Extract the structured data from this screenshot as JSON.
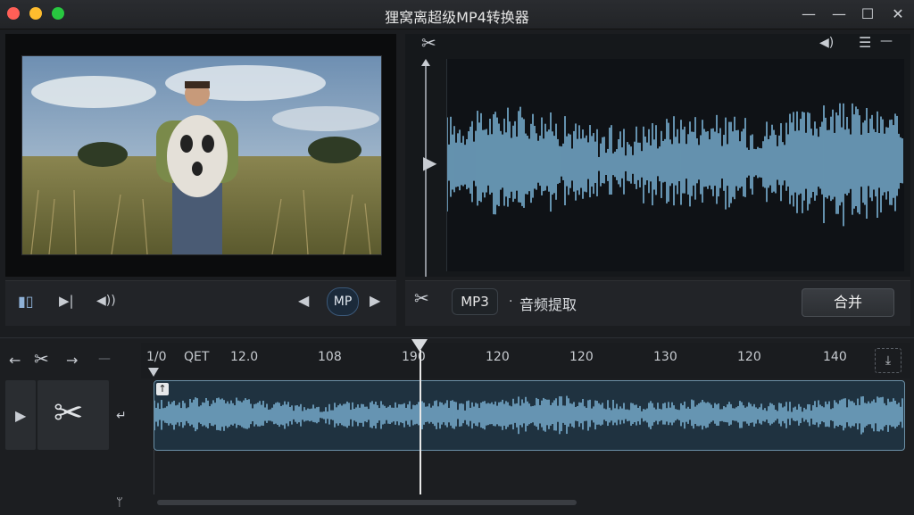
{
  "app": {
    "title": "狸窝离超级MP4转换器"
  },
  "colors": {
    "accent_wave": "#6ea0bf",
    "panel": "#222428",
    "close": "#ff5f57",
    "minimize": "#febc2e",
    "zoom": "#28c840"
  },
  "icons": {
    "cut": "✂",
    "play": "▶",
    "prev": "◀",
    "next": "▶",
    "volume": "◀)",
    "menu": "☰",
    "arrow_left": "←",
    "arrow_right": "→",
    "minus": "—",
    "min": "—",
    "max": "☐",
    "close_x": "✕",
    "split": "▮▯",
    "skip": "▶|",
    "speaker": "◀))",
    "return": "↵",
    "down": "ᛘ",
    "fit": "⤓"
  },
  "player": {
    "format_badge": "MP"
  },
  "audio": {
    "format": "MP3",
    "separator": "·",
    "label": "音频提取",
    "merge_label": "合并"
  },
  "timeline": {
    "ticks": [
      "1/0",
      "QET",
      "12.0",
      "108",
      "190",
      "120",
      "120",
      "130",
      "120",
      "140"
    ]
  }
}
